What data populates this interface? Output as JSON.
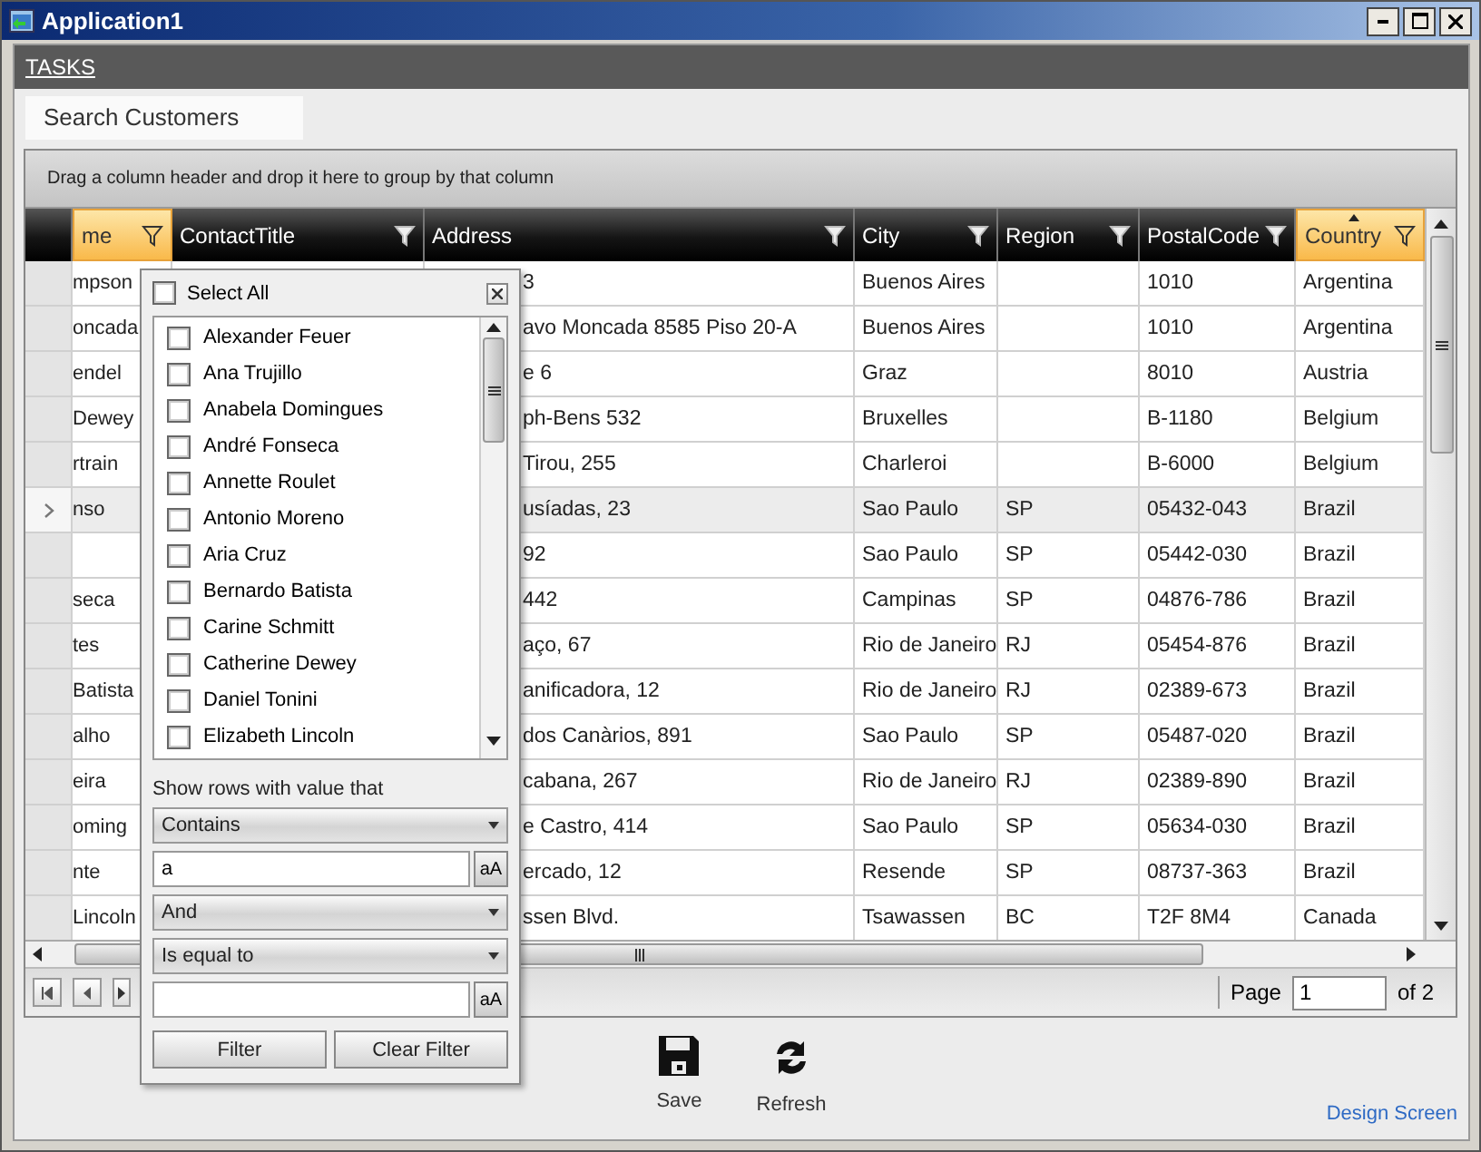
{
  "window": {
    "title": "Application1"
  },
  "menu": {
    "label": "TASKS"
  },
  "tab": {
    "label": "Search Customers",
    "selected": true
  },
  "grid": {
    "group_hint": "Drag a column header and drop it here to group by that column",
    "columns": [
      {
        "label": "me",
        "filtered": true,
        "sorted": false
      },
      {
        "label": "ContactTitle",
        "filtered": false,
        "sorted": false
      },
      {
        "label": "Address",
        "filtered": false,
        "sorted": false
      },
      {
        "label": "City",
        "filtered": false,
        "sorted": false
      },
      {
        "label": "Region",
        "filtered": false,
        "sorted": false
      },
      {
        "label": "PostalCode",
        "filtered": false,
        "sorted": false
      },
      {
        "label": "Country",
        "filtered": true,
        "sorted": true
      }
    ],
    "rows": [
      {
        "current": false,
        "name": "mpson",
        "address": "3",
        "city": "Buenos Aires",
        "postal_code": "1010",
        "country": "Argentina"
      },
      {
        "current": false,
        "name": "oncada",
        "address": "avo Moncada 8585 Piso 20-A",
        "city": "Buenos Aires",
        "postal_code": "1010",
        "country": "Argentina"
      },
      {
        "current": false,
        "name": "endel",
        "address": "e 6",
        "city": "Graz",
        "postal_code": "8010",
        "country": "Austria"
      },
      {
        "current": false,
        "name": "Dewey",
        "address": "ph-Bens 532",
        "city": "Bruxelles",
        "postal_code": "B-1180",
        "country": "Belgium"
      },
      {
        "current": false,
        "name": "rtrain",
        "address": "Tirou, 255",
        "city": "Charleroi",
        "postal_code": "B-6000",
        "country": "Belgium"
      },
      {
        "current": true,
        "name": "nso",
        "address": "usíadas, 23",
        "city": "Sao Paulo",
        "region": "SP",
        "postal_code": "05432-043",
        "country": "Brazil"
      },
      {
        "current": false,
        "address": "92",
        "city": "Sao Paulo",
        "region": "SP",
        "postal_code": "05442-030",
        "country": "Brazil"
      },
      {
        "current": false,
        "name": "seca",
        "address": "442",
        "city": "Campinas",
        "region": "SP",
        "postal_code": "04876-786",
        "country": "Brazil"
      },
      {
        "current": false,
        "name": "tes",
        "address": "aço, 67",
        "city": "Rio de Janeiro",
        "region": "RJ",
        "postal_code": "05454-876",
        "country": "Brazil"
      },
      {
        "current": false,
        "name": "Batista",
        "address": "anificadora, 12",
        "city": "Rio de Janeiro",
        "region": "RJ",
        "postal_code": "02389-673",
        "country": "Brazil"
      },
      {
        "current": false,
        "name": "alho",
        "address": "dos Canàrios, 891",
        "city": "Sao Paulo",
        "region": "SP",
        "postal_code": "05487-020",
        "country": "Brazil"
      },
      {
        "current": false,
        "name": "eira",
        "address": "cabana, 267",
        "city": "Rio de Janeiro",
        "region": "RJ",
        "postal_code": "02389-890",
        "country": "Brazil"
      },
      {
        "current": false,
        "name": "oming",
        "address": "e Castro, 414",
        "city": "Sao Paulo",
        "region": "SP",
        "postal_code": "05634-030",
        "country": "Brazil"
      },
      {
        "current": false,
        "name": "nte",
        "address": "ercado, 12",
        "city": "Resende",
        "region": "SP",
        "postal_code": "08737-363",
        "country": "Brazil"
      },
      {
        "current": false,
        "name": "Lincoln",
        "address": "ssen Blvd.",
        "city": "Tsawassen",
        "region": "BC",
        "postal_code": "T2F 8M4",
        "country": "Canada"
      }
    ],
    "pager": {
      "page_label": "Page",
      "page": "1",
      "total_label": "of 2"
    }
  },
  "filter_popup": {
    "select_all": {
      "label": "Select All",
      "checked": false
    },
    "items": [
      {
        "label": "Alexander Feuer",
        "checked": false
      },
      {
        "label": "Ana Trujillo",
        "checked": false
      },
      {
        "label": "Anabela Domingues",
        "checked": false
      },
      {
        "label": "André Fonseca",
        "checked": false
      },
      {
        "label": "Annette Roulet",
        "checked": false
      },
      {
        "label": "Antonio Moreno",
        "checked": false
      },
      {
        "label": "Aria Cruz",
        "checked": false
      },
      {
        "label": "Bernardo Batista",
        "checked": false
      },
      {
        "label": "Carine Schmitt",
        "checked": false
      },
      {
        "label": "Catherine Dewey",
        "checked": false
      },
      {
        "label": "Daniel Tonini",
        "checked": false
      },
      {
        "label": "Elizabeth Lincoln",
        "checked": false
      }
    ],
    "prompt": "Show rows with value that",
    "operator_1": "Contains",
    "value_1": "a",
    "match_case_1": "aA",
    "logic": "And",
    "operator_2": "Is equal to",
    "match_case_2": "aA",
    "buttons": [
      "Filter",
      "Clear Filter"
    ]
  },
  "commands": [
    {
      "kind": "save",
      "label": "Save"
    },
    {
      "kind": "refresh",
      "label": "Refresh"
    }
  ],
  "design_link": "Design Screen"
}
